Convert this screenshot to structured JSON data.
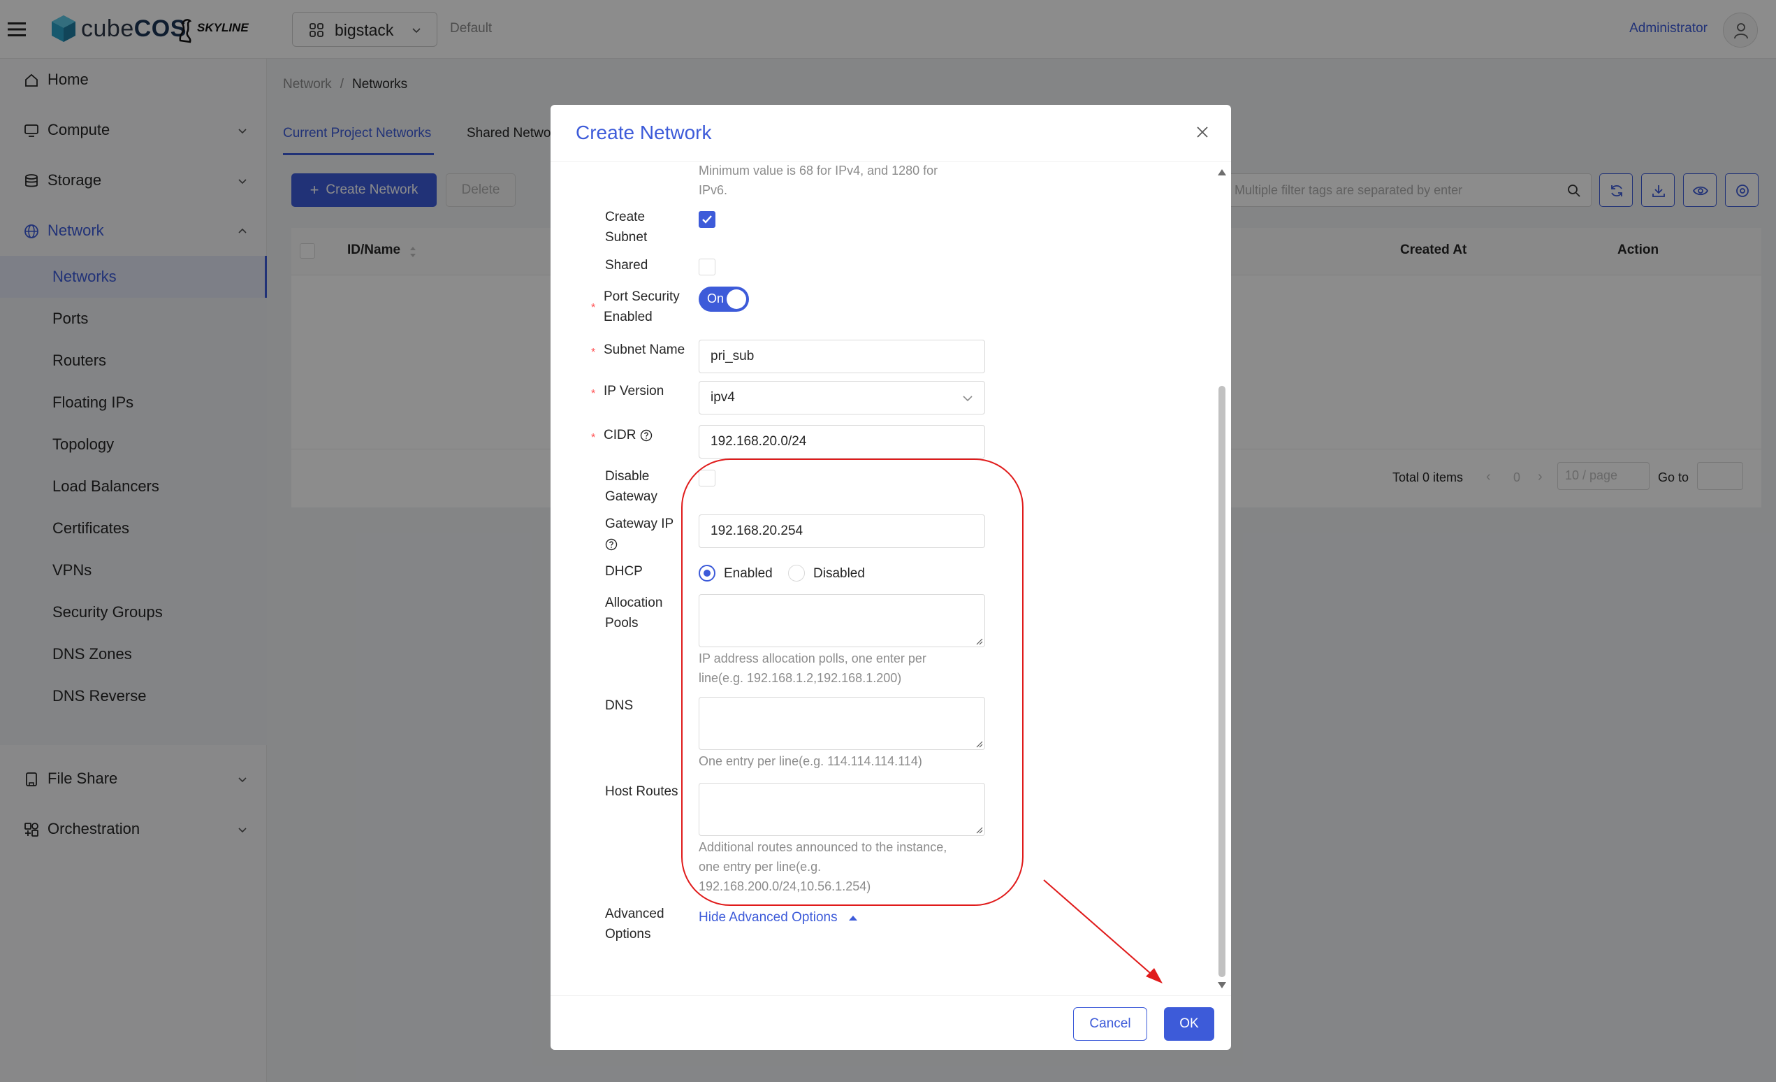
{
  "topbar": {
    "brand_prefix": "cube",
    "brand_suffix": "COS",
    "skyline_text": "SKYLINE",
    "project": "bigstack",
    "domain": "Default",
    "user": "Administrator"
  },
  "sidebar": {
    "home": "Home",
    "compute": "Compute",
    "storage": "Storage",
    "network": "Network",
    "network_items": [
      "Networks",
      "Ports",
      "Routers",
      "Floating IPs",
      "Topology",
      "Load Balancers",
      "Certificates",
      "VPNs",
      "Security Groups",
      "DNS Zones",
      "DNS Reverse"
    ],
    "file_share": "File Share",
    "orchestration": "Orchestration"
  },
  "page": {
    "breadcrumb_parent": "Network",
    "breadcrumb_sep": "/",
    "breadcrumb_current": "Networks",
    "tab_current": "Current Project Networks",
    "tab_shared": "Shared Netwo",
    "create_button": "Create Network",
    "delete_button": "Delete",
    "search_placeholder": "Multiple filter tags are separated by enter",
    "col_id_name": "ID/Name",
    "col_created_at": "Created At",
    "col_action": "Action",
    "total_items": "Total 0 items",
    "page_number": "0",
    "page_size": "10 / page",
    "goto_label": "Go to"
  },
  "modal": {
    "title": "Create Network",
    "mtu_hint": "Minimum value is 68 for IPv4, and 1280 for IPv6.",
    "mtu_hint_line1": "Minimum value is 68 for IPv4, and 1280 for",
    "mtu_hint_line2": "IPv6.",
    "create_subnet_label_1": "Create",
    "create_subnet_label_2": "Subnet",
    "create_subnet_checked": true,
    "shared_label": "Shared",
    "port_security_label_1": "Port Security",
    "port_security_label_2": "Enabled",
    "port_security_state": "On",
    "subnet_name_label": "Subnet Name",
    "subnet_name_value": "pri_sub",
    "ip_version_label": "IP Version",
    "ip_version_value": "ipv4",
    "cidr_label": "CIDR",
    "cidr_value": "192.168.20.0/24",
    "disable_gateway_label_1": "Disable",
    "disable_gateway_label_2": "Gateway",
    "gateway_ip_label": "Gateway IP",
    "gateway_ip_value": "192.168.20.254",
    "dhcp_label": "DHCP",
    "dhcp_enabled": "Enabled",
    "dhcp_disabled": "Disabled",
    "allocation_pools_label_1": "Allocation",
    "allocation_pools_label_2": "Pools",
    "allocation_hint_1": "IP address allocation polls, one enter per",
    "allocation_hint_2": "line(e.g. 192.168.1.2,192.168.1.200)",
    "dns_label": "DNS",
    "dns_hint": "One entry per line(e.g. 114.114.114.114)",
    "host_routes_label": "Host Routes",
    "host_routes_hint_1": "Additional routes announced to the instance,",
    "host_routes_hint_2": "one entry per line(e.g.",
    "host_routes_hint_3": "192.168.200.0/24,10.56.1.254)",
    "advanced_label_1": "Advanced",
    "advanced_label_2": "Options",
    "advanced_link": "Hide Advanced Options",
    "cancel_button": "Cancel",
    "ok_button": "OK"
  },
  "colors": {
    "primary": "#3d5bd9",
    "required": "#ff4d4f",
    "annotation": "#e01b1b"
  }
}
